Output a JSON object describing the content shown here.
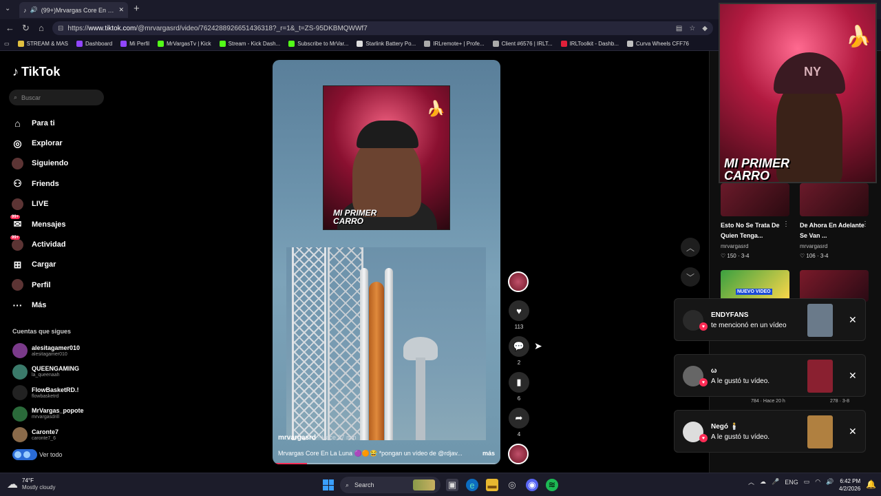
{
  "browser": {
    "tab_title": "(99+)Mrvargas Core En La Lu",
    "url_prefix": "https://",
    "url_host": "www.tiktok.com",
    "url_path": "/@mrvargasrd/video/7624288926651436318?_r=1&_t=ZS-95DKBMQWWf7",
    "bookmarks": [
      {
        "label": "STREAM & MAS",
        "color": "#e0c040"
      },
      {
        "label": "Dashboard",
        "color": "#9146ff"
      },
      {
        "label": "Mi Perfil",
        "color": "#9146ff"
      },
      {
        "label": "MrVargasTv | Kick",
        "color": "#53fc18"
      },
      {
        "label": "Stream - Kick Dash...",
        "color": "#53fc18"
      },
      {
        "label": "Subscribe to MrVar...",
        "color": "#53fc18"
      },
      {
        "label": "Starlink Battery Po...",
        "color": "#dddddd"
      },
      {
        "label": "IRLremote+ | Profe...",
        "color": "#aaaaaa"
      },
      {
        "label": "Client #6576 | IRLT...",
        "color": "#aaaaaa"
      },
      {
        "label": "IRLToolkit - Dashb...",
        "color": "#e0203a"
      },
      {
        "label": "Curva Wheels CFF76",
        "color": "#c0c0c0"
      }
    ]
  },
  "tiktok": {
    "logo": "TikTok",
    "search_placeholder": "Buscar",
    "nav": [
      {
        "label": "Para ti",
        "icon": "home-icon"
      },
      {
        "label": "Explorar",
        "icon": "compass-icon"
      },
      {
        "label": "Siguiendo",
        "icon": "following-icon"
      },
      {
        "label": "Friends",
        "icon": "friends-icon"
      },
      {
        "label": "LIVE",
        "icon": "live-icon"
      },
      {
        "label": "Mensajes",
        "icon": "messages-icon",
        "badge": "99+"
      },
      {
        "label": "Actividad",
        "icon": "activity-icon",
        "badge": "99+"
      },
      {
        "label": "Cargar",
        "icon": "upload-icon"
      },
      {
        "label": "Perfil",
        "icon": "profile-icon"
      },
      {
        "label": "Más",
        "icon": "more-icon"
      }
    ],
    "following_title": "Cuentas que sigues",
    "following": [
      {
        "name": "alesitagamer010",
        "handle": "alesitagamer010",
        "color": "#7a3a8a"
      },
      {
        "name": "QUEENGAMING",
        "handle": "la_queenaah",
        "color": "#3a7a6a"
      },
      {
        "name": "FlowBasketRD.!",
        "handle": "flowbasketrd",
        "color": "#222222"
      },
      {
        "name": "MrVargas_popote",
        "handle": "mrvargasdrill",
        "color": "#2a6a3a"
      },
      {
        "name": "Caronte7",
        "handle": "caronte7_6",
        "color": "#8a6a4a"
      }
    ],
    "ver_todo": "Ver todo"
  },
  "video": {
    "overlay_text_1": "MI PRIMER",
    "overlay_text_2": "CARRO",
    "author": "mrvargasrd",
    "time_ago": "· Hace 27 min",
    "description": "Mrvargas Core En La Luna 🟣🟠😂 *pongan un vídeo de @rdjav...",
    "more": "más",
    "progress": 0.15
  },
  "actions": {
    "likes": "113",
    "comments": "2",
    "saves": "6",
    "shares": "4"
  },
  "right_panel": {
    "videos": [
      {
        "title": "Esto No Se Trata De Quien Tenga...",
        "user": "mrvargasrd",
        "likes": "150",
        "date": "3-4"
      },
      {
        "title": "De Ahora En Adelante Se Van ...",
        "user": "mrvargasrd",
        "likes": "106",
        "date": "3-4"
      }
    ],
    "thumb_label": "NUEVO VIDEO",
    "partial_stats_1": "784 · Hace 20 h",
    "partial_stats_2": "278 · 3-8"
  },
  "camera": {
    "text_1": "MI PRIMER",
    "text_2": "CARRO"
  },
  "notifications": [
    {
      "name": "ENDYFANS",
      "message": "te mencionó en un vídeo",
      "avatar_color": "#2a2a2a",
      "thumb_color": "#6a7a8a"
    },
    {
      "name": "ω",
      "message": "A le gustó tu vídeo.",
      "avatar_color": "#666666",
      "thumb_color": "#8a2030"
    },
    {
      "name": "Negó 🕯️",
      "message": "A le gustó tu vídeo.",
      "avatar_color": "#dddddd",
      "thumb_color": "#b08040"
    }
  ],
  "taskbar": {
    "temperature": "74°F",
    "weather": "Mostly cloudy",
    "search": "Search",
    "language": "ENG",
    "time": "6:42 PM",
    "date": "4/2/2026"
  }
}
